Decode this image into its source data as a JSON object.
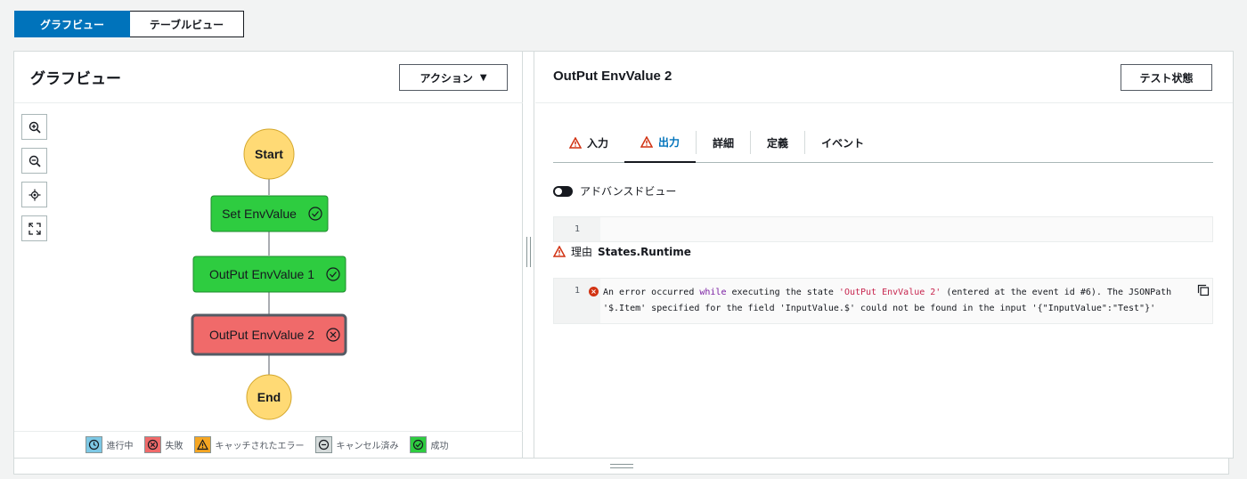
{
  "view_toggle": {
    "graph": "グラフビュー",
    "table": "テーブルビュー"
  },
  "left": {
    "title": "グラフビュー",
    "action_label": "アクション",
    "action_caret": "▼"
  },
  "graph": {
    "nodes": [
      {
        "label": "Start",
        "status": "terminal"
      },
      {
        "label": "Set EnvValue",
        "status": "succeeded"
      },
      {
        "label": "OutPut EnvValue 1",
        "status": "succeeded"
      },
      {
        "label": "OutPut EnvValue 2",
        "status": "failed"
      },
      {
        "label": "End",
        "status": "terminal"
      }
    ]
  },
  "legend": {
    "in_progress": "進行中",
    "failed": "失敗",
    "caught_error": "キャッチされたエラー",
    "cancelled": "キャンセル済み",
    "succeeded": "成功"
  },
  "right": {
    "title": "OutPut EnvValue 2",
    "test_label": "テスト状態",
    "tabs": [
      "入力",
      "出力",
      "詳細",
      "定義",
      "イベント"
    ],
    "advanced_view": "アドバンスドビュー",
    "line1": "1",
    "reason_label": "理由",
    "reason_value": "States.Runtime",
    "error_line": "1",
    "error_seg1": "An error occurred ",
    "error_kw": "while",
    "error_seg2": " executing the state ",
    "error_str": "'OutPut EnvValue 2'",
    "error_seg3": " (entered at the event id #6). The JSONPath",
    "error_line2": "'$.Item' specified for the field 'InputValue.$' could not be found in the input '{\"InputValue\":\"Test\"}'"
  },
  "colors": {
    "accent": "#0073bb",
    "success": "#2ecc40",
    "failed": "#f06a6a",
    "terminal": "#ffda75",
    "error": "#d13212"
  }
}
